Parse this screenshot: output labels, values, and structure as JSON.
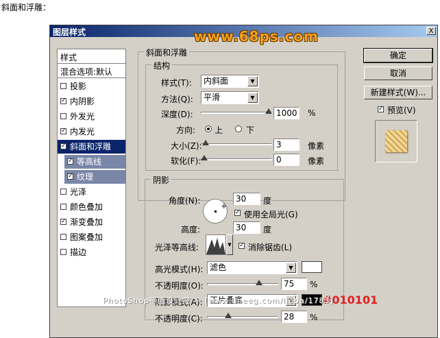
{
  "caption": "斜面和浮雕：",
  "dialog": {
    "title": "图层样式",
    "watermark": "www.68ps.com",
    "close_label": "X"
  },
  "styles_panel": {
    "header": "样式",
    "blend_options": "混合选项:默认",
    "items": [
      {
        "label": "投影",
        "checked": false
      },
      {
        "label": "内阴影",
        "checked": true
      },
      {
        "label": "外发光",
        "checked": false
      },
      {
        "label": "内发光",
        "checked": true
      },
      {
        "label": "斜面和浮雕",
        "checked": true,
        "selected": true
      },
      {
        "label": "等高线",
        "checked": true,
        "sub": true
      },
      {
        "label": "纹理",
        "checked": true,
        "sub": true
      },
      {
        "label": "光泽",
        "checked": false
      },
      {
        "label": "颜色叠加",
        "checked": false
      },
      {
        "label": "渐变叠加",
        "checked": true
      },
      {
        "label": "图案叠加",
        "checked": false
      },
      {
        "label": "描边",
        "checked": false
      }
    ]
  },
  "bevel": {
    "group_title": "斜面和浮雕",
    "structure_title": "结构",
    "style_label": "样式(T):",
    "style_value": "内斜面",
    "method_label": "方法(Q):",
    "method_value": "平滑",
    "depth_label": "深度(D):",
    "depth_value": "1000",
    "depth_unit": "%",
    "depth_fraction": 1.0,
    "direction_label": "方向:",
    "direction_up": "上",
    "direction_down": "下",
    "direction_selected": "up",
    "size_label": "大小(Z):",
    "size_value": "3",
    "size_unit": "像素",
    "size_fraction": 0.02,
    "soften_label": "软化(F):",
    "soften_value": "0",
    "soften_unit": "像素",
    "soften_fraction": 0.0
  },
  "shading": {
    "title": "阴影",
    "angle_label": "角度(N):",
    "angle_value": "30",
    "angle_unit": "度",
    "global_light_label": "使用全局光(G)",
    "global_light_checked": true,
    "altitude_label": "高度:",
    "altitude_value": "30",
    "altitude_unit": "度",
    "gloss_contour_label": "光泽等高线:",
    "antialias_label": "消除锯齿(L)",
    "antialias_checked": true,
    "highlight_mode_label": "高光模式(H):",
    "highlight_mode_value": "滤色",
    "highlight_color": "#ffffff",
    "highlight_opacity_label": "不透明度(O):",
    "highlight_opacity_value": "75",
    "highlight_opacity_unit": "%",
    "highlight_opacity_fraction": 0.75,
    "shadow_mode_label": "阴影模式(A):",
    "shadow_mode_value": "正片叠底",
    "shadow_color": "#010101",
    "shadow_color_note": "#010101",
    "shadow_opacity_label": "不透明度(C):",
    "shadow_opacity_value": "28",
    "shadow_opacity_unit": "%",
    "shadow_opacity_fraction": 0.28
  },
  "buttons": {
    "ok": "确定",
    "cancel": "取消",
    "new_style": "新建样式(W)...",
    "preview_label": "预览(V)",
    "preview_checked": true
  },
  "footer_watermark": "PhotoShop平面设计吧 — [www.lineeg.com/lieba/1783]",
  "colors": {
    "accent": "#0a246a",
    "watermark": "#f0a020",
    "note": "#e02020"
  }
}
